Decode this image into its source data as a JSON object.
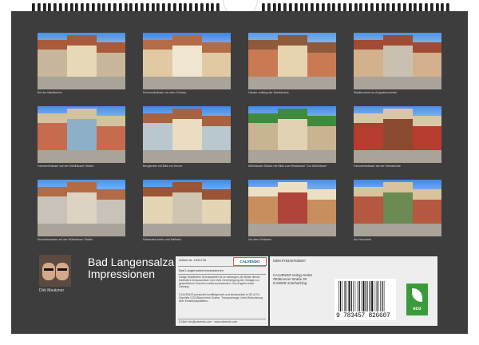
{
  "photos": [
    {
      "caption": "Bei der Marktkirche",
      "sky": "#4b8fe0",
      "c1": "#c8b79a",
      "c2": "#a85a3a",
      "c3": "#e7d9b8"
    },
    {
      "caption": "Fachwerkhäuser vor dem Schloss",
      "sky": "#3f86e6",
      "c1": "#e1c9a4",
      "c2": "#b46b48",
      "c3": "#f0e6d0"
    },
    {
      "caption": "Häuser entlang der Marktstraße",
      "sky": "#5a9ae6",
      "c1": "#c97a52",
      "c2": "#8e5a3c",
      "c3": "#e8d3b0"
    },
    {
      "caption": "Stadtbrunnen im Augustinerviertel",
      "sky": "#4e93e4",
      "c1": "#d3b18c",
      "c2": "#a14a35",
      "c3": "#c9c0b0"
    },
    {
      "caption": "Fachwerkhäuser auf der Mühlhäuser Straße",
      "sky": "#4a8de8",
      "c1": "#c76b4f",
      "c2": "#d3c29e",
      "c3": "#8db0c8"
    },
    {
      "caption": "Bergstraße mit Blick zur Kirche",
      "sky": "#3d86e8",
      "c1": "#b9c8cf",
      "c2": "#a7623f",
      "c3": "#eadcbf"
    },
    {
      "caption": "Mühlhäuser Straße mit Blick zum Restaurant \"Zur Mühlhäuse\"",
      "sky": "#3f8be9",
      "c1": "#c8b491",
      "c2": "#3f8a3c",
      "c3": "#e1d1b3"
    },
    {
      "caption": "Fachwerkhäuser auf der Marktstraße",
      "sky": "#4a90e8",
      "c1": "#b53c2f",
      "c2": "#d8c6a6",
      "c3": "#8a4a30"
    },
    {
      "caption": "Einkaufsstrasse auf der Mühlhäuser Straße",
      "sky": "#4d92e8",
      "c1": "#c9c2b8",
      "c2": "#b36b45",
      "c3": "#dcd3c3"
    },
    {
      "caption": "Rathausbrunnen und Rathaus",
      "sky": "#3e8ae8",
      "c1": "#e4d6b4",
      "c2": "#9b5434",
      "c3": "#cfc5b0"
    },
    {
      "caption": "Vor dem Schlosse",
      "sky": "#4b8fe6",
      "c1": "#c88e5e",
      "c2": "#ebe0c4",
      "c3": "#b0443a"
    },
    {
      "caption": "Am Neumarkt",
      "sky": "#3f88e8",
      "c1": "#b4583f",
      "c2": "#d9c39c",
      "c3": "#6a8a52"
    }
  ],
  "author": {
    "name": "Dirk Meutzner"
  },
  "title": {
    "line1": "Bad Langensalza",
    "line2": "Impressionen"
  },
  "info": {
    "article": "Artikel-Nr. 1996718",
    "logo": "CALVENDO",
    "book_title": "Bad Langensalza Impressionen",
    "desc": "Infolge bewährtem Schutzpartner ist zu verlangen, die Bilder dieses Kalenders herauszulösen und ohne Genehmigung des Verlages zu gewerblichen Zwecken weiterzuverwenden. Das Angebot einer Zahlung.",
    "desc2": "CALVENDO produziert konfliktgerecht und klimaneutral in DE & EU. Geprüfte CO2-Bilanz beim Sucher. Transportwege, hohe Reduzierung ihrer Emissionsplattform.",
    "contact": "E-Mail: info@calvendo.com  ·  www.calvendo.com"
  },
  "publisher": {
    "isbn": "ISBN 9783457826607",
    "name": "CALVENDO Verlag GmbH",
    "street": "Ottobrunner Straße 39",
    "city": "D-82008 Unterhaching"
  },
  "barcode": {
    "number": "9 783457 826607"
  },
  "eco": {
    "label": "eco"
  }
}
